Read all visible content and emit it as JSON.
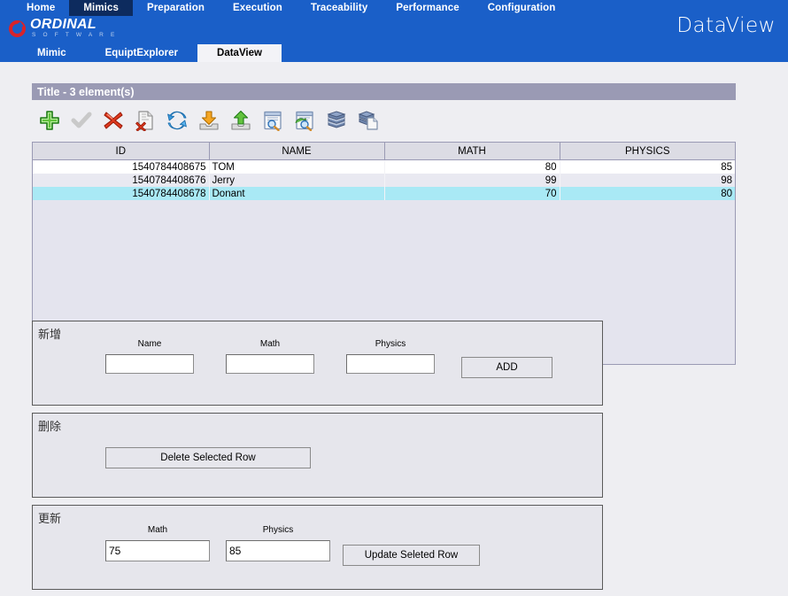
{
  "header": {
    "top_nav": [
      {
        "label": "Home",
        "active": false
      },
      {
        "label": "Mimics",
        "active": true
      },
      {
        "label": "Preparation",
        "active": false
      },
      {
        "label": "Execution",
        "active": false
      },
      {
        "label": "Traceability",
        "active": false
      },
      {
        "label": "Performance",
        "active": false
      },
      {
        "label": "Configuration",
        "active": false
      }
    ],
    "logo": {
      "name": "ORDINAL",
      "sub": "S O F T W A R E"
    },
    "page_label": "DataView",
    "sub_nav": [
      {
        "label": "Mimic",
        "active": false
      },
      {
        "label": "EquiptExplorer",
        "active": false
      },
      {
        "label": "DataView",
        "active": true
      }
    ]
  },
  "panel_title": "Title - 3 element(s)",
  "toolbar": [
    {
      "name": "add-row-icon",
      "tip": "Add"
    },
    {
      "name": "validate-check-icon",
      "tip": "Validate"
    },
    {
      "name": "delete-cross-icon",
      "tip": "Delete"
    },
    {
      "name": "delete-document-icon",
      "tip": "Delete document"
    },
    {
      "name": "refresh-icon",
      "tip": "Refresh"
    },
    {
      "name": "import-icon",
      "tip": "Import"
    },
    {
      "name": "export-icon",
      "tip": "Export"
    },
    {
      "name": "search-document-icon",
      "tip": "Search document"
    },
    {
      "name": "search-refresh-document-icon",
      "tip": "Refresh query"
    },
    {
      "name": "database-icon",
      "tip": "Database"
    },
    {
      "name": "database-document-icon",
      "tip": "Database document"
    }
  ],
  "table": {
    "columns": [
      "ID",
      "NAME",
      "MATH",
      "PHYSICS"
    ],
    "rows": [
      {
        "id": "1540784408675",
        "name": "TOM",
        "math": "80",
        "physics": "85",
        "selected": false
      },
      {
        "id": "1540784408676",
        "name": "Jerry",
        "math": "99",
        "physics": "98",
        "selected": false
      },
      {
        "id": "1540784408678",
        "name": "Donant",
        "math": "70",
        "physics": "80",
        "selected": true
      }
    ]
  },
  "add_panel": {
    "legend": "新增",
    "name_label": "Name",
    "math_label": "Math",
    "physics_label": "Physics",
    "name_value": "",
    "math_value": "",
    "physics_value": "",
    "button": "ADD"
  },
  "delete_panel": {
    "legend": "删除",
    "button": "Delete Selected Row"
  },
  "update_panel": {
    "legend": "更新",
    "math_label": "Math",
    "physics_label": "Physics",
    "math_value": "75",
    "physics_value": "85",
    "button": "Update Seleted Row"
  },
  "colors": {
    "header_blue": "#1a5fc8",
    "active_tab": "#0d2b5e",
    "title_bar": "#9a9ab4",
    "selection": "#a9e9f5",
    "page_bg": "#eeeef2"
  }
}
